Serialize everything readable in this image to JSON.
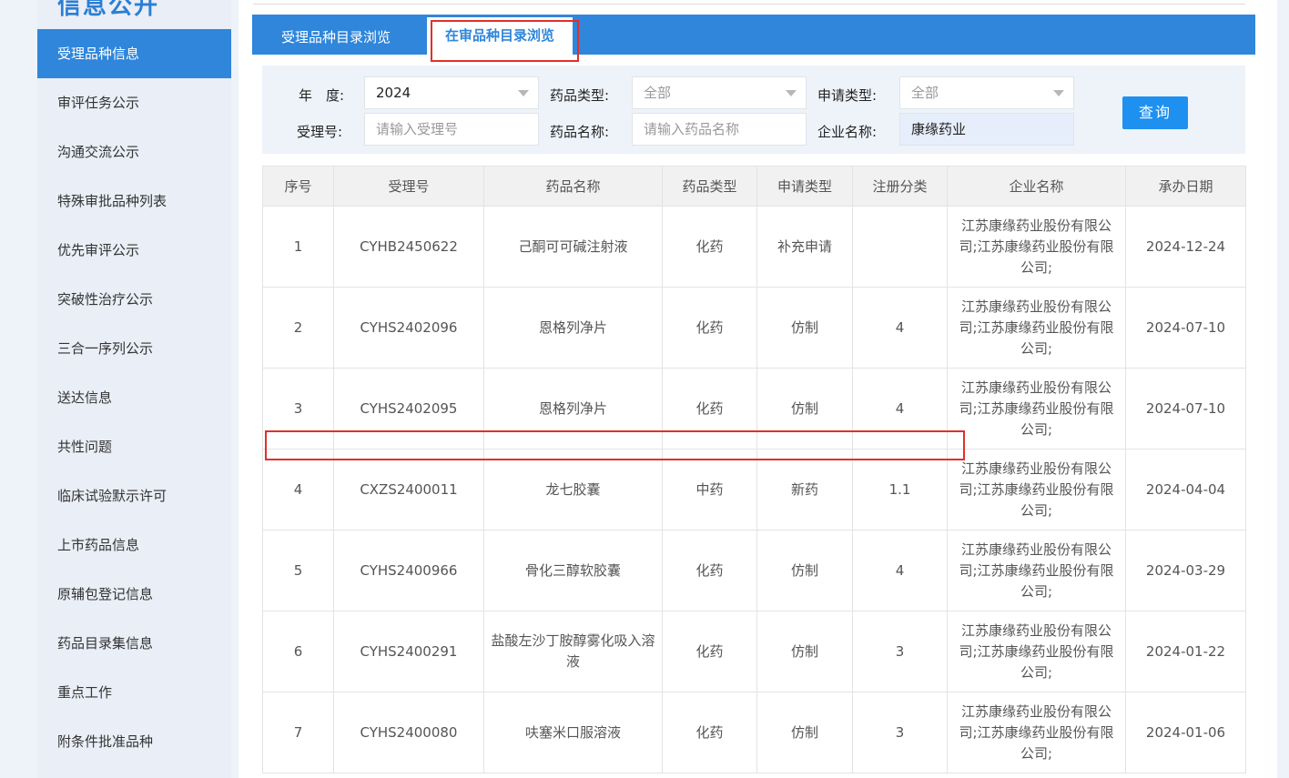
{
  "sidebar": {
    "title": "信息公开",
    "items": [
      {
        "label": "受理品种信息",
        "active": true
      },
      {
        "label": "审评任务公示"
      },
      {
        "label": "沟通交流公示"
      },
      {
        "label": "特殊审批品种列表"
      },
      {
        "label": "优先审评公示"
      },
      {
        "label": "突破性治疗公示"
      },
      {
        "label": "三合一序列公示"
      },
      {
        "label": "送达信息"
      },
      {
        "label": "共性问题"
      },
      {
        "label": "临床试验默示许可"
      },
      {
        "label": "上市药品信息"
      },
      {
        "label": "原辅包登记信息"
      },
      {
        "label": "药品目录集信息"
      },
      {
        "label": "重点工作"
      },
      {
        "label": "附条件批准品种"
      }
    ]
  },
  "tabs": [
    "受理品种目录浏览",
    "在审品种目录浏览"
  ],
  "filters": {
    "year_label": "年　度:",
    "year_value": "2024",
    "drug_type_label": "药品类型:",
    "drug_type_value": "全部",
    "apply_type_label": "申请类型:",
    "apply_type_value": "全部",
    "accept_no_label": "受理号:",
    "accept_no_placeholder": "请输入受理号",
    "drug_name_label": "药品名称:",
    "drug_name_placeholder": "请输入药品名称",
    "company_label": "企业名称:",
    "company_value": "康缘药业",
    "query_button": "查询"
  },
  "table": {
    "headers": [
      "序号",
      "受理号",
      "药品名称",
      "药品类型",
      "申请类型",
      "注册分类",
      "企业名称",
      "承办日期"
    ],
    "rows": [
      [
        "1",
        "CYHB2450622",
        "己酮可可碱注射液",
        "化药",
        "补充申请",
        "",
        "江苏康缘药业股份有限公司;江苏康缘药业股份有限公司;",
        "2024-12-24"
      ],
      [
        "2",
        "CYHS2402096",
        "恩格列净片",
        "化药",
        "仿制",
        "4",
        "江苏康缘药业股份有限公司;江苏康缘药业股份有限公司;",
        "2024-07-10"
      ],
      [
        "3",
        "CYHS2402095",
        "恩格列净片",
        "化药",
        "仿制",
        "4",
        "江苏康缘药业股份有限公司;江苏康缘药业股份有限公司;",
        "2024-07-10"
      ],
      [
        "4",
        "CXZS2400011",
        "龙七胶囊",
        "中药",
        "新药",
        "1.1",
        "江苏康缘药业股份有限公司;江苏康缘药业股份有限公司;",
        "2024-04-04"
      ],
      [
        "5",
        "CYHS2400966",
        "骨化三醇软胶囊",
        "化药",
        "仿制",
        "4",
        "江苏康缘药业股份有限公司;江苏康缘药业股份有限公司;",
        "2024-03-29"
      ],
      [
        "6",
        "CYHS2400291",
        "盐酸左沙丁胺醇雾化吸入溶液",
        "化药",
        "仿制",
        "3",
        "江苏康缘药业股份有限公司;江苏康缘药业股份有限公司;",
        "2024-01-22"
      ],
      [
        "7",
        "CYHS2400080",
        "呋塞米口服溶液",
        "化药",
        "仿制",
        "3",
        "江苏康缘药业股份有限公司;江苏康缘药业股份有限公司;",
        "2024-01-06"
      ]
    ]
  }
}
